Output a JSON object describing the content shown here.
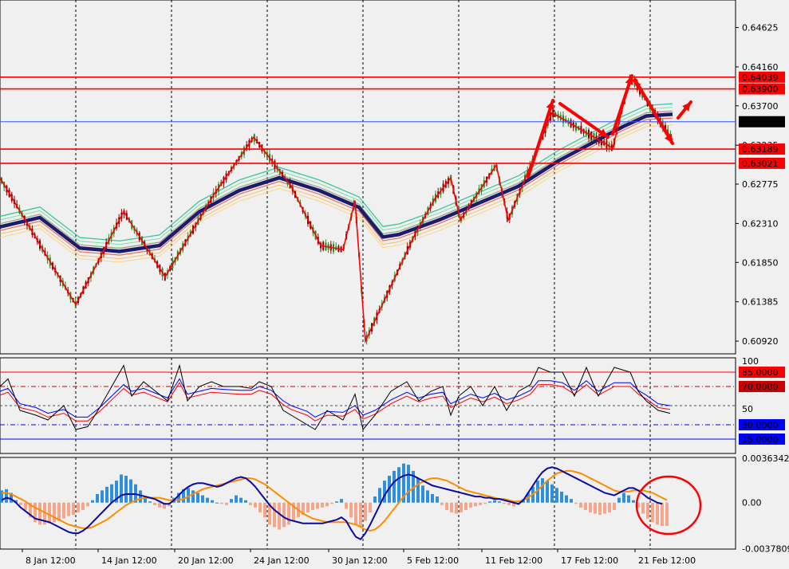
{
  "chart_data": [
    {
      "panel": "price",
      "type": "candlestick",
      "y_ticks": [
        "0.64625",
        "0.64160",
        "0.63700",
        "0.63235",
        "0.62775",
        "0.62310",
        "0.61850",
        "0.61385",
        "0.60920"
      ],
      "ylim": [
        0.6077,
        0.6495
      ],
      "levels": [
        {
          "label": "0.64039",
          "value": 0.64039,
          "color": "#ff0000",
          "boxed": true
        },
        {
          "label": "0.63900",
          "value": 0.639,
          "color": "#ff0000",
          "boxed": true
        },
        {
          "label": "0.63512",
          "value": 0.63512,
          "color": "#3355ff",
          "boxed": true,
          "box_color": "#000000"
        },
        {
          "label": "0.63189",
          "value": 0.63189,
          "color": "#ff0000",
          "boxed": true
        },
        {
          "label": "0.63021",
          "value": 0.63021,
          "color": "#ff0000",
          "boxed": true
        }
      ],
      "zigzag_points": [
        [
          0,
          0.6285
        ],
        [
          95,
          0.6135
        ],
        [
          155,
          0.6245
        ],
        [
          207,
          0.6168
        ],
        [
          268,
          0.6265
        ],
        [
          318,
          0.6333
        ],
        [
          365,
          0.6275
        ],
        [
          402,
          0.6205
        ],
        [
          430,
          0.62
        ],
        [
          445,
          0.6258
        ],
        [
          458,
          0.6092
        ],
        [
          520,
          0.6218
        ],
        [
          545,
          0.626
        ],
        [
          565,
          0.6285
        ],
        [
          577,
          0.6235
        ],
        [
          622,
          0.63
        ],
        [
          637,
          0.6235
        ],
        [
          692,
          0.6362
        ],
        [
          768,
          0.632
        ],
        [
          790,
          0.6405
        ],
        [
          843,
          0.633
        ]
      ],
      "trend_x": [
        0,
        50,
        100,
        150,
        200,
        250,
        300,
        350,
        400,
        450,
        480,
        500,
        550,
        600,
        650,
        700,
        750,
        780,
        810,
        843
      ],
      "trend_y": [
        0.6227,
        0.6238,
        0.6202,
        0.6198,
        0.6205,
        0.6245,
        0.627,
        0.6285,
        0.627,
        0.625,
        0.6215,
        0.6218,
        0.6235,
        0.6255,
        0.6275,
        0.6305,
        0.633,
        0.6345,
        0.6358,
        0.636
      ]
    },
    {
      "panel": "oscillator",
      "type": "line",
      "y_ticks": [
        "100",
        "50"
      ],
      "ylim": [
        0,
        100
      ],
      "levels": [
        {
          "label": "85.0000",
          "value": 85,
          "color": "#ff0000",
          "dash": false,
          "boxed": true
        },
        {
          "label": "70.0000",
          "value": 70,
          "color": "#cc0000",
          "dash": true,
          "boxed": true
        },
        {
          "label": "30.0000",
          "value": 30,
          "color": "#0000ff",
          "dash": true,
          "boxed": true
        },
        {
          "label": "15.0000",
          "value": 15,
          "color": "#0000ff",
          "dash": false,
          "boxed": true
        }
      ],
      "fast_x": [
        0,
        10,
        25,
        45,
        60,
        80,
        95,
        110,
        125,
        140,
        155,
        165,
        180,
        195,
        210,
        225,
        235,
        250,
        265,
        280,
        300,
        315,
        325,
        340,
        355,
        365,
        385,
        395,
        410,
        430,
        445,
        455,
        470,
        490,
        510,
        525,
        540,
        555,
        565,
        575,
        590,
        605,
        620,
        635,
        650,
        665,
        675,
        690,
        705,
        720,
        735,
        750,
        770,
        790,
        800,
        810,
        825,
        840
      ],
      "fast_y": [
        70,
        78,
        45,
        40,
        35,
        50,
        25,
        28,
        48,
        70,
        92,
        60,
        75,
        65,
        55,
        92,
        55,
        70,
        75,
        70,
        70,
        68,
        75,
        70,
        45,
        40,
        30,
        25,
        45,
        35,
        62,
        25,
        40,
        65,
        75,
        55,
        65,
        70,
        40,
        60,
        70,
        50,
        70,
        45,
        65,
        72,
        90,
        85,
        85,
        60,
        90,
        60,
        90,
        85,
        65,
        55,
        45,
        42
      ],
      "slow_y": [
        65,
        68,
        52,
        48,
        42,
        46,
        38,
        38,
        48,
        60,
        72,
        65,
        68,
        63,
        58,
        78,
        62,
        65,
        68,
        67,
        66,
        66,
        70,
        66,
        55,
        50,
        44,
        38,
        44,
        43,
        50,
        40,
        45,
        56,
        64,
        58,
        62,
        64,
        52,
        56,
        62,
        58,
        63,
        56,
        60,
        66,
        76,
        76,
        74,
        66,
        76,
        65,
        74,
        74,
        66,
        61,
        52,
        50
      ]
    },
    {
      "panel": "macd",
      "type": "bar",
      "y_ticks": [
        "0.0036342",
        "0.00",
        "-0.0037809"
      ],
      "ylim": [
        -0.0038,
        0.0037
      ],
      "hist_x": [
        0,
        6,
        12,
        18,
        24,
        30,
        36,
        42,
        48,
        54,
        60,
        66,
        72,
        78,
        84,
        90,
        96,
        102,
        108,
        114,
        120,
        126,
        132,
        138,
        144,
        150,
        156,
        162,
        168,
        174,
        180,
        186,
        192,
        198,
        204,
        210,
        216,
        222,
        228,
        234,
        240,
        246,
        252,
        258,
        264,
        270,
        276,
        282,
        288,
        294,
        300,
        306,
        312,
        318,
        324,
        330,
        336,
        342,
        348,
        354,
        360,
        366,
        372,
        378,
        384,
        390,
        396,
        402,
        408,
        414,
        420,
        426,
        432,
        438,
        444,
        450,
        456,
        462,
        468,
        474,
        480,
        486,
        492,
        498,
        504,
        510,
        516,
        522,
        528,
        534,
        540,
        546,
        552,
        558,
        564,
        570,
        576,
        582,
        588,
        594,
        600,
        606,
        612,
        618,
        624,
        630,
        636,
        642,
        648,
        654,
        660,
        666,
        672,
        678,
        684,
        690,
        696,
        702,
        708,
        714,
        720,
        726,
        732,
        738,
        744,
        750,
        756,
        762,
        768,
        774,
        780,
        786,
        792,
        798,
        804,
        810,
        816,
        822,
        828,
        834,
        840
      ],
      "hist_y": [
        0.001,
        0.0011,
        0.0008,
        0.0002,
        -0.0002,
        -0.0006,
        -0.0012,
        -0.0016,
        -0.0018,
        -0.0018,
        -0.0017,
        -0.0016,
        -0.0015,
        -0.0013,
        -0.0011,
        -0.001,
        -0.0008,
        -0.0006,
        -0.0003,
        0.0002,
        0.0007,
        0.001,
        0.0013,
        0.0015,
        0.0018,
        0.0023,
        0.0022,
        0.0019,
        0.0015,
        0.001,
        0.0005,
        0.0001,
        -0.0002,
        -0.0004,
        -0.0005,
        -0.0003,
        0.0004,
        0.0008,
        0.0011,
        0.0012,
        0.001,
        0.0008,
        0.0006,
        0.0004,
        0.0002,
        0.0,
        -0.0001,
        -0.0002,
        0.0003,
        0.0006,
        0.0004,
        0.0002,
        -0.0002,
        -0.0004,
        -0.0008,
        -0.0012,
        -0.0018,
        -0.002,
        -0.0022,
        -0.002,
        -0.0018,
        -0.0015,
        -0.0012,
        -0.001,
        -0.0008,
        -0.0006,
        -0.0005,
        -0.0004,
        -0.0003,
        -0.0001,
        0.0001,
        0.0003,
        -0.0005,
        -0.0012,
        -0.0018,
        -0.002,
        -0.0015,
        -0.0008,
        0.0005,
        0.0012,
        0.0018,
        0.0022,
        0.0026,
        0.0029,
        0.0032,
        0.0031,
        0.0026,
        0.002,
        0.0014,
        0.001,
        0.0007,
        0.0005,
        -0.0002,
        -0.0006,
        -0.0008,
        -0.0009,
        -0.0008,
        -0.0006,
        -0.0004,
        -0.0003,
        -0.0002,
        -0.0001,
        0.0001,
        0.0002,
        0.0001,
        -0.0001,
        -0.0002,
        -0.0003,
        -0.0002,
        0.0003,
        0.0008,
        0.0013,
        0.0018,
        0.002,
        0.0018,
        0.0015,
        0.0012,
        0.0009,
        0.0006,
        0.0003,
        -0.0001,
        -0.0004,
        -0.0006,
        -0.0008,
        -0.0009,
        -0.001,
        -0.0009,
        -0.0008,
        -0.0006,
        0.0004,
        0.0008,
        0.0006,
        0.0002,
        -0.0004,
        -0.0009,
        -0.0013,
        -0.0016,
        -0.0018,
        -0.0019,
        -0.0019
      ],
      "macd_y": [
        0.0002,
        0.0004,
        0.0003,
        0.0,
        -0.0004,
        -0.0007,
        -0.001,
        -0.0013,
        -0.0014,
        -0.0015,
        -0.0016,
        -0.0018,
        -0.002,
        -0.0022,
        -0.0024,
        -0.0025,
        -0.0025,
        -0.0023,
        -0.002,
        -0.0016,
        -0.0012,
        -0.0008,
        -0.0004,
        0.0,
        0.0003,
        0.0006,
        0.0007,
        0.0007,
        0.0007,
        0.0006,
        0.0005,
        0.0004,
        0.0003,
        0.0001,
        -0.0001,
        -0.0001,
        0.0002,
        0.0006,
        0.001,
        0.0013,
        0.0015,
        0.0016,
        0.0016,
        0.0015,
        0.0014,
        0.0013,
        0.0014,
        0.0016,
        0.0018,
        0.002,
        0.0021,
        0.002,
        0.0017,
        0.0013,
        0.0008,
        0.0003,
        -0.0002,
        -0.0006,
        -0.0009,
        -0.0012,
        -0.0014,
        -0.0015,
        -0.0016,
        -0.0017,
        -0.0017,
        -0.0017,
        -0.0017,
        -0.0017,
        -0.0016,
        -0.0015,
        -0.0014,
        -0.0012,
        -0.0015,
        -0.0022,
        -0.0028,
        -0.003,
        -0.0025,
        -0.0018,
        -0.001,
        -0.0002,
        0.0006,
        0.0012,
        0.0017,
        0.002,
        0.0022,
        0.0023,
        0.0022,
        0.002,
        0.0018,
        0.0016,
        0.0014,
        0.0013,
        0.0012,
        0.0011,
        0.001,
        0.0009,
        0.0008,
        0.0007,
        0.0006,
        0.0005,
        0.0005,
        0.0004,
        0.0004,
        0.0003,
        0.0003,
        0.0002,
        0.0001,
        0.0,
        -0.0001,
        0.0002,
        0.0008,
        0.0014,
        0.002,
        0.0025,
        0.0028,
        0.0029,
        0.0028,
        0.0026,
        0.0024,
        0.0022,
        0.002,
        0.0018,
        0.0016,
        0.0014,
        0.0012,
        0.001,
        0.0008,
        0.0007,
        0.0006,
        0.0008,
        0.001,
        0.0012,
        0.0012,
        0.001,
        0.0007,
        0.0004,
        0.0002,
        0.0,
        -0.0001
      ],
      "signal_y": [
        0.0008,
        0.0008,
        0.0007,
        0.0005,
        0.0003,
        0.0001,
        -0.0002,
        -0.0004,
        -0.0006,
        -0.0008,
        -0.001,
        -0.0012,
        -0.0014,
        -0.0016,
        -0.0018,
        -0.0019,
        -0.002,
        -0.0021,
        -0.0021,
        -0.002,
        -0.0018,
        -0.0016,
        -0.0014,
        -0.0011,
        -0.0008,
        -0.0005,
        -0.0002,
        0.0,
        0.0002,
        0.0003,
        0.0004,
        0.0004,
        0.0004,
        0.0004,
        0.0003,
        0.0002,
        0.0002,
        0.0002,
        0.0003,
        0.0005,
        0.0007,
        0.0009,
        0.0011,
        0.0012,
        0.0013,
        0.0014,
        0.0015,
        0.0016,
        0.0017,
        0.0018,
        0.0019,
        0.002,
        0.002,
        0.0019,
        0.0017,
        0.0015,
        0.0012,
        0.0009,
        0.0006,
        0.0003,
        0.0,
        -0.0003,
        -0.0006,
        -0.0009,
        -0.0011,
        -0.0013,
        -0.0014,
        -0.0015,
        -0.0016,
        -0.0016,
        -0.0016,
        -0.0016,
        -0.0016,
        -0.0017,
        -0.0018,
        -0.002,
        -0.0022,
        -0.0023,
        -0.0022,
        -0.0019,
        -0.0015,
        -0.001,
        -0.0005,
        0.0,
        0.0005,
        0.0009,
        0.0012,
        0.0015,
        0.0017,
        0.0019,
        0.002,
        0.002,
        0.0019,
        0.0018,
        0.0016,
        0.0014,
        0.0012,
        0.001,
        0.0009,
        0.0008,
        0.0007,
        0.0006,
        0.0005,
        0.0004,
        0.0003,
        0.0003,
        0.0002,
        0.0001,
        0.0001,
        0.0002,
        0.0004,
        0.0007,
        0.001,
        0.0014,
        0.0018,
        0.0021,
        0.0024,
        0.0025,
        0.0026,
        0.0026,
        0.0025,
        0.0024,
        0.0022,
        0.002,
        0.0018,
        0.0016,
        0.0014,
        0.0012,
        0.001,
        0.0009,
        0.0009,
        0.0009,
        0.001,
        0.001,
        0.001,
        0.0009,
        0.0008,
        0.0006,
        0.0004,
        0.0002
      ]
    }
  ],
  "x_axis": {
    "labels": [
      "8 Jan 12:00",
      "14 Jan 12:00",
      "20 Jan 12:00",
      "24 Jan 12:00",
      "30 Jan 12:00",
      "5 Feb 12:00",
      "11 Feb 12:00",
      "17 Feb 12:00",
      "21 Feb 12:00"
    ]
  },
  "colors": {
    "background": "#f0f0f0",
    "grid": "#000000",
    "zigzag": "#ff0000",
    "trend": "#1c1c6e",
    "osc_fast": "#000000",
    "osc_red": "#ff0000",
    "osc_blue": "#0000ff",
    "macd_line": "#0a0aa0",
    "signal_line": "#ff8c00",
    "hist_pos": "#2e8fdc",
    "hist_neg": "#f4a58a"
  }
}
